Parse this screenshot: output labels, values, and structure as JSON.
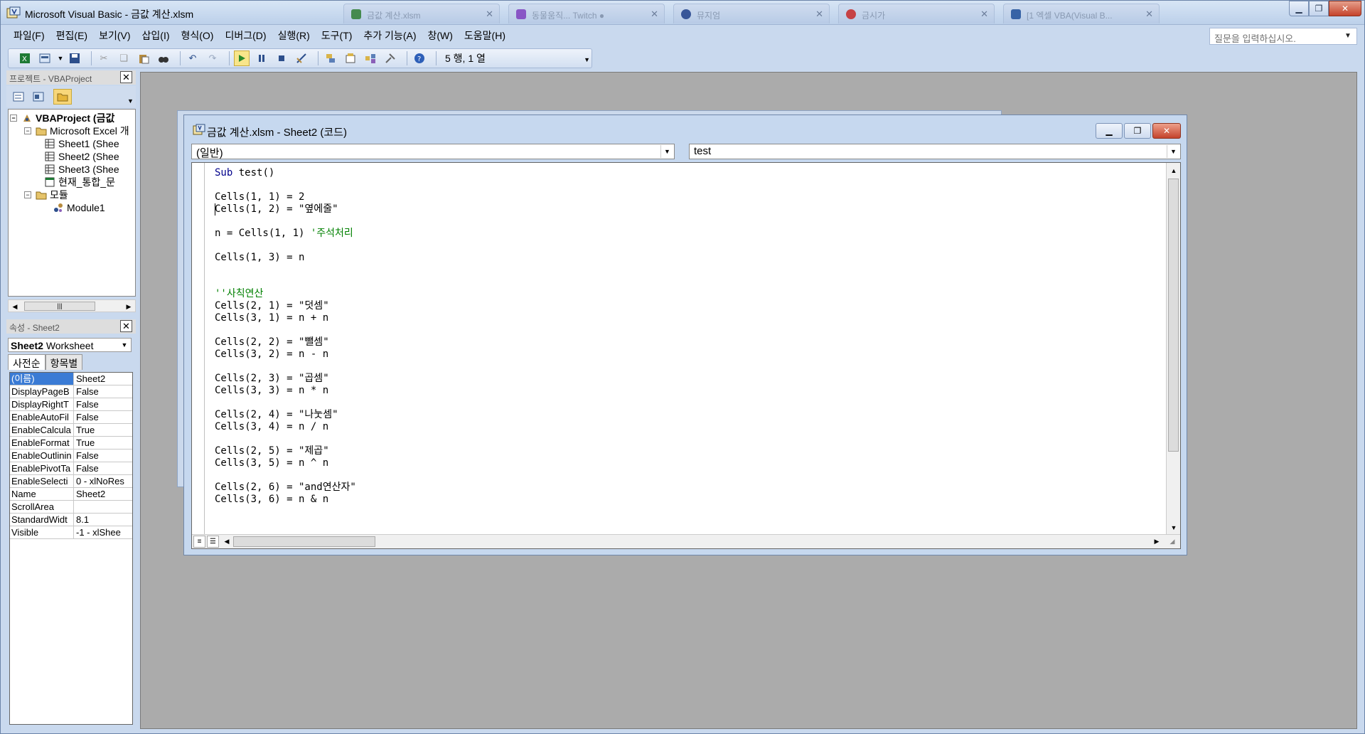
{
  "window": {
    "title": "Microsoft Visual Basic - 금값 계산.xlsm",
    "bg_tabs": [
      {
        "label": "금값 계산.xlsm",
        "color": "#2e7d32"
      },
      {
        "label": "동물움직... Twitch ●",
        "color": "#7e3fbf"
      },
      {
        "label": "뮤지엄",
        "color": "#1f3f8a"
      },
      {
        "label": "금시가",
        "color": "#c62828"
      },
      {
        "label": "[1 엑셀 VBA(Visual B...",
        "color": "#1f4f9a"
      }
    ]
  },
  "menu": [
    "파일(F)",
    "편집(E)",
    "보기(V)",
    "삽입(I)",
    "형식(O)",
    "디버그(D)",
    "실행(R)",
    "도구(T)",
    "추가 기능(A)",
    "창(W)",
    "도움말(H)"
  ],
  "help_box": {
    "placeholder": "질문을 입력하십시오."
  },
  "toolbar": {
    "cursor_position": "5 행, 1 열"
  },
  "project_explorer": {
    "title": "프로젝트 - VBAProject",
    "root": "VBAProject (금값",
    "excel_objects": "Microsoft Excel 개",
    "sheets": [
      "Sheet1 (Shee",
      "Sheet2 (Shee",
      "Sheet3 (Shee"
    ],
    "workbook": "현재_통합_문",
    "modules_folder": "모듈",
    "module": "Module1"
  },
  "properties": {
    "title": "속성 - Sheet2",
    "object_name": "Sheet2",
    "object_type": "Worksheet",
    "tab_alpha": "사전순",
    "tab_category": "항목별",
    "rows": [
      {
        "name": "(이름)",
        "value": "Sheet2"
      },
      {
        "name": "DisplayPageB",
        "value": "False"
      },
      {
        "name": "DisplayRightT",
        "value": "False"
      },
      {
        "name": "EnableAutoFil",
        "value": "False"
      },
      {
        "name": "EnableCalcula",
        "value": "True"
      },
      {
        "name": "EnableFormat",
        "value": "True"
      },
      {
        "name": "EnableOutlinin",
        "value": "False"
      },
      {
        "name": "EnablePivotTa",
        "value": "False"
      },
      {
        "name": "EnableSelecti",
        "value": "0 - xlNoRes"
      },
      {
        "name": "Name",
        "value": "Sheet2"
      },
      {
        "name": "ScrollArea",
        "value": ""
      },
      {
        "name": "StandardWidt",
        "value": "8.1"
      },
      {
        "name": "Visible",
        "value": "-1 - xlShee"
      }
    ]
  },
  "code_window": {
    "title": "금값 계산.xlsm - Sheet2 (코드)",
    "object_combo": "(일반)",
    "procedure_combo": "test",
    "lines": [
      {
        "kw": "Sub",
        "text": " test()"
      },
      {
        "text": ""
      },
      {
        "text": "Cells(1, 1) = 2"
      },
      {
        "text": "Cells(1, 2) = \"옆에줄\""
      },
      {
        "text": ""
      },
      {
        "text": "n = Cells(1, 1) ",
        "cm": "'주석처리"
      },
      {
        "text": ""
      },
      {
        "text": "Cells(1, 3) = n"
      },
      {
        "text": ""
      },
      {
        "text": ""
      },
      {
        "text": "",
        "cm": "''사칙연산"
      },
      {
        "text": "Cells(2, 1) = \"덧셈\""
      },
      {
        "text": "Cells(3, 1) = n + n"
      },
      {
        "text": ""
      },
      {
        "text": "Cells(2, 2) = \"뺄셈\""
      },
      {
        "text": "Cells(3, 2) = n - n"
      },
      {
        "text": ""
      },
      {
        "text": "Cells(2, 3) = \"곱셈\""
      },
      {
        "text": "Cells(3, 3) = n * n"
      },
      {
        "text": ""
      },
      {
        "text": "Cells(2, 4) = \"나눗셈\""
      },
      {
        "text": "Cells(3, 4) = n / n"
      },
      {
        "text": ""
      },
      {
        "text": "Cells(2, 5) = \"제곱\""
      },
      {
        "text": "Cells(3, 5) = n ^ n"
      },
      {
        "text": ""
      },
      {
        "text": "Cells(2, 6) = \"and연산자\""
      },
      {
        "text": "Cells(3, 6) = n & n"
      }
    ]
  }
}
